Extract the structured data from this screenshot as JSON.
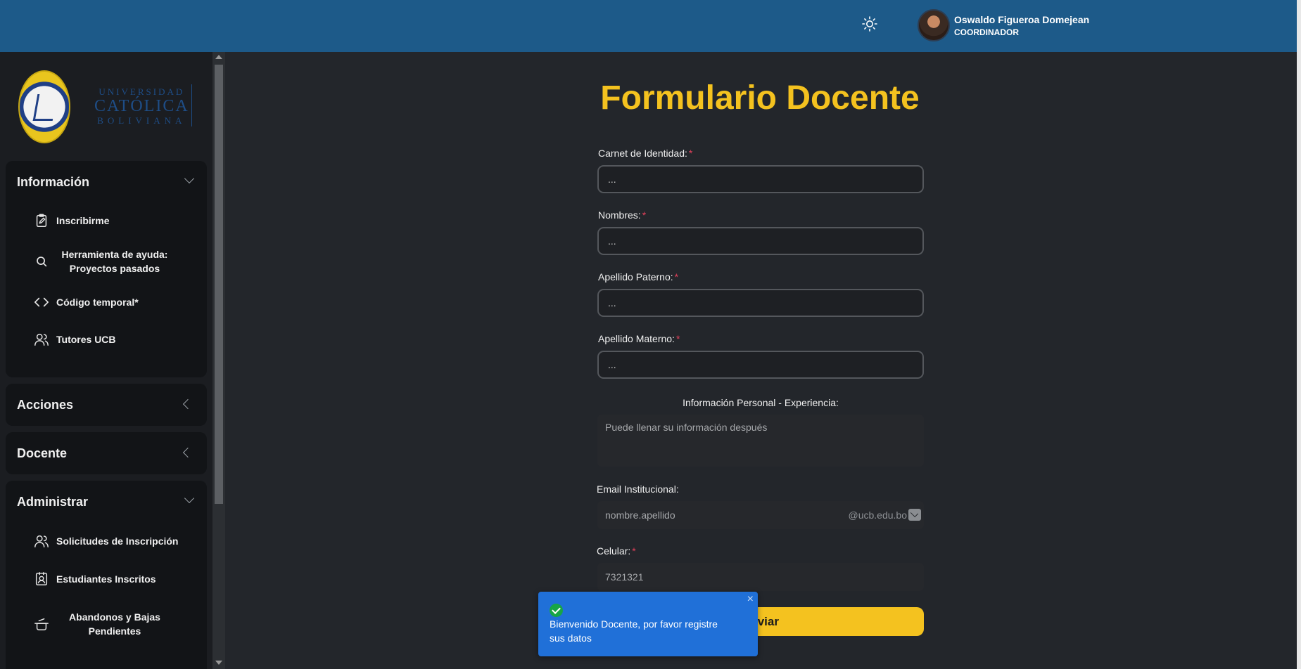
{
  "header": {
    "theme_icon": "sun-icon",
    "user_name": "Oswaldo Figueroa Domejean",
    "user_role": "COORDINADOR"
  },
  "sidebar": {
    "logo": {
      "line1": "UNIVERSIDAD",
      "line2": "CATÓLICA",
      "line3": "BOLIVIANA"
    },
    "groups": [
      {
        "title": "Información",
        "expanded": true,
        "items": [
          {
            "label": "Inscribirme",
            "icon": "clipboard-edit-icon"
          },
          {
            "label": "Herramienta de ayuda: Proyectos pasados",
            "icon": "search-icon"
          },
          {
            "label": "Código temporal*",
            "icon": "code-icon"
          },
          {
            "label": "Tutores UCB",
            "icon": "users-icon"
          }
        ]
      },
      {
        "title": "Acciones",
        "expanded": false,
        "items": []
      },
      {
        "title": "Docente",
        "expanded": false,
        "items": []
      },
      {
        "title": "Administrar",
        "expanded": true,
        "items": [
          {
            "label": "Solicitudes de Inscripción",
            "icon": "users-icon"
          },
          {
            "label": "Estudiantes Inscritos",
            "icon": "id-badge-icon"
          },
          {
            "label": "Abandonos y Bajas Pendientes",
            "icon": "cooking-pot-icon"
          }
        ]
      }
    ]
  },
  "form": {
    "title": "Formulario Docente",
    "fields": [
      {
        "label": "Carnet de Identidad:",
        "required_mark": "*",
        "placeholder": "..."
      },
      {
        "label": "Nombres:",
        "required_mark": "*",
        "placeholder": "..."
      },
      {
        "label": "Apellido Paterno:",
        "required_mark": "*",
        "placeholder": "..."
      },
      {
        "label": "Apellido Materno:",
        "required_mark": "*",
        "placeholder": "..."
      }
    ],
    "experience": {
      "label": "Información Personal - Experiencia:",
      "placeholder": "Puede llenar su información después"
    },
    "email": {
      "label": "Email Institucional:",
      "placeholder": "nombre.apellido",
      "suffix": "@ucb.edu.bo"
    },
    "phone": {
      "label": "Celular:",
      "required_mark": "*",
      "value": "7321321"
    },
    "submit_label": "Enviar"
  },
  "toast": {
    "message": "Bienvenido Docente, por favor registre sus datos",
    "close": "×",
    "color": "#2070d8"
  },
  "colors": {
    "accent": "#f4c21f",
    "header": "#1d5a89",
    "background": "#23262b"
  }
}
